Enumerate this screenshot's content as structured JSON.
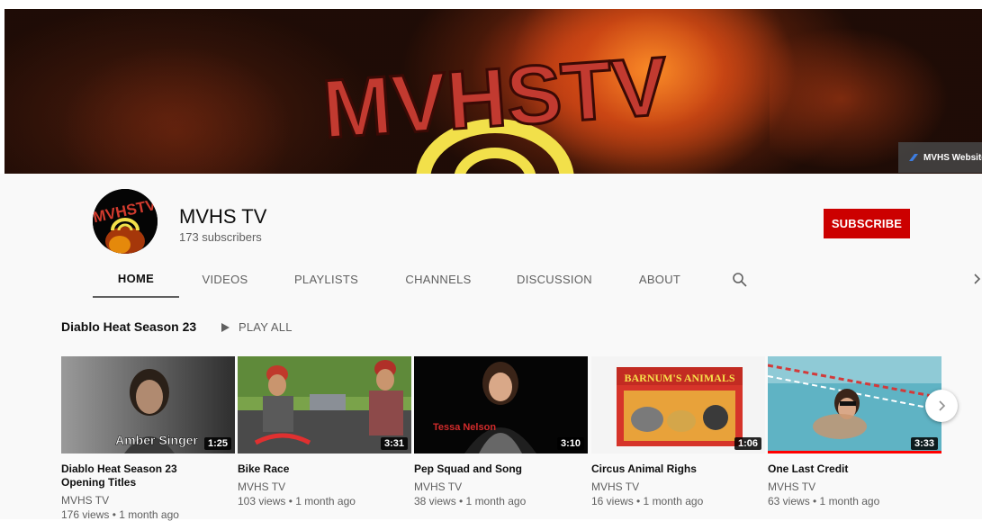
{
  "banner": {
    "logo_text": "MVHSTV",
    "website_link": "MVHS Website"
  },
  "channel": {
    "name": "MVHS TV",
    "subscribers": "173 subscribers",
    "subscribe_label": "SUBSCRIBE"
  },
  "tabs": [
    {
      "label": "HOME",
      "active": true
    },
    {
      "label": "VIDEOS"
    },
    {
      "label": "PLAYLISTS"
    },
    {
      "label": "CHANNELS"
    },
    {
      "label": "DISCUSSION"
    },
    {
      "label": "ABOUT"
    }
  ],
  "shelf": {
    "title": "Diablo Heat Season 23",
    "play_all": "PLAY ALL",
    "videos": [
      {
        "title": "Diablo Heat Season 23 Opening Titles",
        "channel": "MVHS TV",
        "meta": "176 views • 1 month ago",
        "duration": "1:25",
        "overlay": "Amber Singer"
      },
      {
        "title": "Bike Race",
        "channel": "MVHS TV",
        "meta": "103 views • 1 month ago",
        "duration": "3:31"
      },
      {
        "title": "Pep Squad and Song",
        "channel": "MVHS TV",
        "meta": "38 views • 1 month ago",
        "duration": "3:10",
        "overlay": "Tessa Nelson"
      },
      {
        "title": "Circus Animal Righs",
        "channel": "MVHS TV",
        "meta": "16 views • 1 month ago",
        "duration": "1:06",
        "overlay": "BARNUM'S ANIMALS"
      },
      {
        "title": "One Last Credit",
        "channel": "MVHS TV",
        "meta": "63 views • 1 month ago",
        "duration": "3:33"
      }
    ]
  },
  "colors": {
    "subscribe": "#cc0000",
    "progress": "#ff0000",
    "page_bg": "#f9f9f9"
  }
}
